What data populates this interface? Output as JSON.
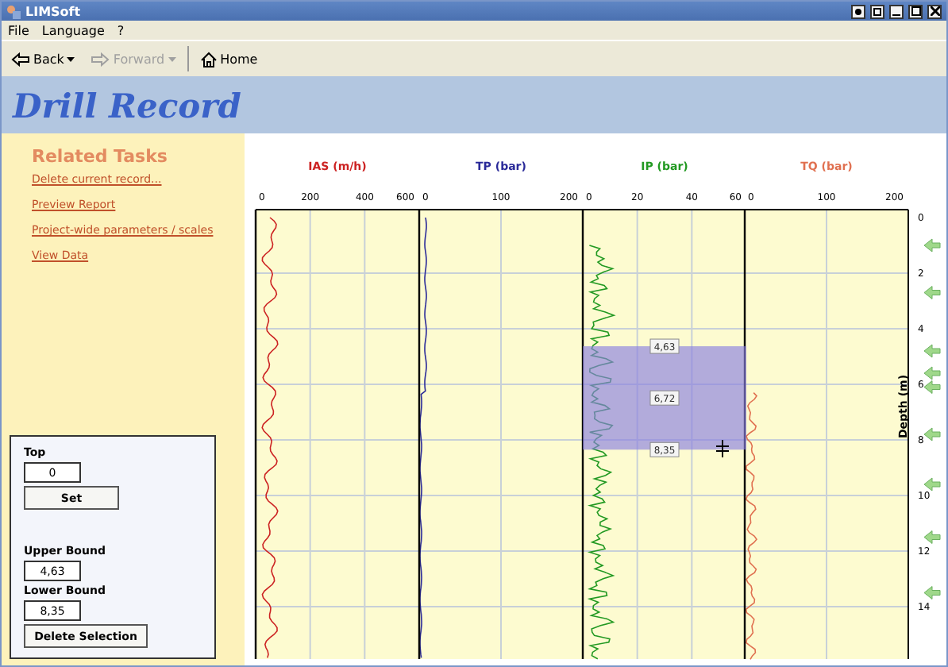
{
  "window": {
    "title": "LIMSoft"
  },
  "menu": [
    "File",
    "Language",
    "?"
  ],
  "toolbar": [
    {
      "label": "Back",
      "kind": "back",
      "disabled": false
    },
    {
      "label": "Forward",
      "kind": "forward",
      "disabled": true
    },
    {
      "label": "Home",
      "kind": "home",
      "disabled": false
    }
  ],
  "header": {
    "title": "Drill Record"
  },
  "related_tasks": {
    "title": "Related Tasks",
    "links": [
      "Delete current record...",
      "Preview Report",
      "Project-wide parameters / scales",
      "View Data"
    ]
  },
  "selection_form": {
    "top_label": "Top",
    "top_value": "0",
    "set_button": "Set",
    "upper_label": "Upper Bound",
    "upper_value": "4,63",
    "lower_label": "Lower Bound",
    "lower_value": "8,35",
    "delete_button": "Delete Selection"
  },
  "plot": {
    "tracks": [
      {
        "title": "IAS (m/h)",
        "color": "#cc2222",
        "ticks": [
          "0",
          "200",
          "400",
          "600"
        ]
      },
      {
        "title": "TP (bar)",
        "color": "#2a2a99",
        "ticks": [
          "0",
          "100",
          "200"
        ]
      },
      {
        "title": "IP (bar)",
        "color": "#229922",
        "ticks": [
          "0",
          "20",
          "40",
          "60"
        ]
      },
      {
        "title": "TQ (bar)",
        "color": "#e07050",
        "ticks": [
          "0",
          "100",
          "200"
        ]
      }
    ],
    "depth_ticks": [
      "0",
      "2",
      "4",
      "6",
      "8",
      "10",
      "12",
      "14"
    ],
    "depth_label": "Depth (m)",
    "selection": {
      "upper": "4,63",
      "middle": "6,72",
      "lower": "8,35"
    }
  }
}
